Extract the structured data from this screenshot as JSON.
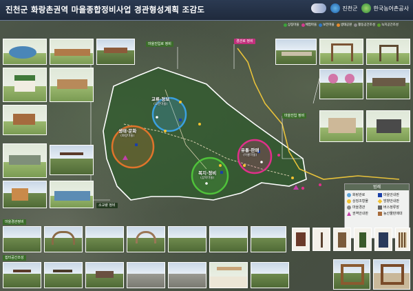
{
  "header": {
    "title": "진천군 화랑촌권역 마을종합정비사업 경관형성계획 조감도",
    "logo_left": "진천군",
    "logo_right": "한국농어촌공사"
  },
  "categories": [
    {
      "label": "상징마을",
      "color": "#3ba33b"
    },
    {
      "label": "체험마을",
      "color": "#d23b8e"
    },
    {
      "label": "보전마을",
      "color": "#2e78c7"
    },
    {
      "label": "생태공원",
      "color": "#e68b2e"
    },
    {
      "label": "활동공간조성",
      "color": "#8a8a8a"
    },
    {
      "label": "녹지공간조성",
      "color": "#5ba02b"
    }
  ],
  "map_tags": {
    "top_center": "마을진입로 정비",
    "top_right": "경관로 정비",
    "right_mid": "마을진입 정비",
    "left_bottom": "소교량 정비"
  },
  "zones": [
    {
      "name": "교류·정보",
      "sub": "(오분마을)",
      "color": "#3aa0e0"
    },
    {
      "name": "생태·문화",
      "sub": "(화랑마을)",
      "color": "#e0742b"
    },
    {
      "name": "유통·판매",
      "sub": "(어룡마을)",
      "color": "#e0308a"
    },
    {
      "name": "복지·정비",
      "sub": "(삼북마을)",
      "color": "#4fc23a"
    }
  ],
  "legend": {
    "title": "범례",
    "items": [
      {
        "label": "화랑관로",
        "shape": "circle",
        "color": "#5ba3d9"
      },
      {
        "label": "마을안내판",
        "shape": "square",
        "color": "#1a3fa8"
      },
      {
        "label": "상징조형물",
        "shape": "circle",
        "color": "#f2c230"
      },
      {
        "label": "방향안내판",
        "shape": "diamond",
        "color": "#f2c230"
      },
      {
        "label": "마을경관",
        "shape": "circle",
        "color": "#8a8a8a"
      },
      {
        "label": "버스정류장",
        "shape": "square",
        "color": "#666666"
      },
      {
        "label": "권역안내판",
        "shape": "triangle",
        "color": "#c23fa8"
      },
      {
        "label": "농산물판매대",
        "shape": "square",
        "color": "#a86b3a"
      }
    ]
  },
  "bottom": {
    "band1": "마을경관정비",
    "band2": "쉼터공간조성"
  }
}
